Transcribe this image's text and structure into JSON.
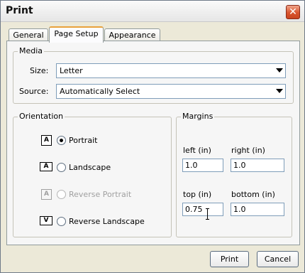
{
  "window": {
    "title": "Print"
  },
  "tabs": [
    {
      "label": "General",
      "active": false
    },
    {
      "label": "Page Setup",
      "active": true
    },
    {
      "label": "Appearance",
      "active": false
    }
  ],
  "media": {
    "legend": "Media",
    "size_label": "Size:",
    "size_value": "Letter",
    "source_label": "Source:",
    "source_value": "Automatically Select"
  },
  "orientation": {
    "legend": "Orientation",
    "options": [
      {
        "label": "Portrait",
        "selected": true,
        "enabled": true,
        "icon_glyph": "A"
      },
      {
        "label": "Landscape",
        "selected": false,
        "enabled": true,
        "icon_glyph": "A"
      },
      {
        "label": "Reverse Portrait",
        "selected": false,
        "enabled": false,
        "icon_glyph": "A"
      },
      {
        "label": "Reverse Landscape",
        "selected": false,
        "enabled": true,
        "icon_glyph": "V"
      }
    ]
  },
  "margins": {
    "legend": "Margins",
    "left_label": "left (in)",
    "left_value": "1.0",
    "right_label": "right (in)",
    "right_value": "1.0",
    "top_label": "top (in)",
    "top_value": "0.75",
    "bottom_label": "bottom (in)",
    "bottom_value": "1.0"
  },
  "buttons": {
    "print": "Print",
    "cancel": "Cancel"
  },
  "colors": {
    "accent_tab": "#e9a23b",
    "close_button": "#d9542e"
  }
}
